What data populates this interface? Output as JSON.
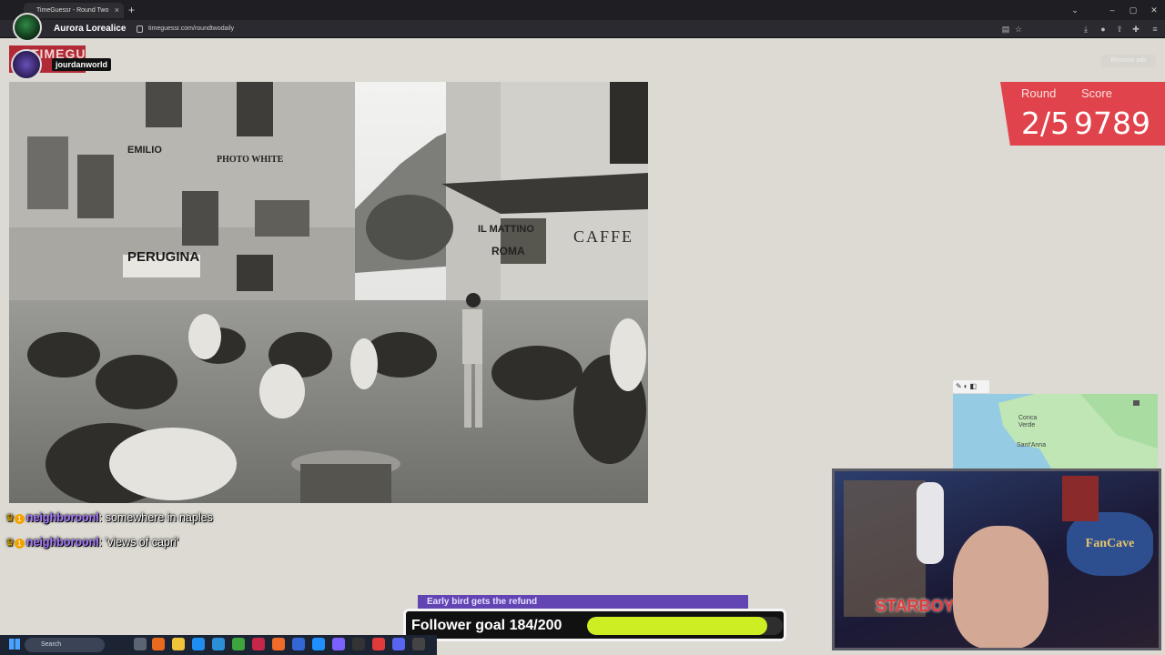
{
  "browser": {
    "tab_title": "TimeGuessr - Round Two",
    "tab_close": "×",
    "new_tab": "+",
    "url": "timeguessr.com/roundtwodaily",
    "profile_name": "Aurora Lorealice",
    "window_controls": {
      "minimize": "–",
      "maximize": "▢",
      "close": "✕",
      "tabs_menu": "⌄"
    }
  },
  "stream_overlay": {
    "username": "jourdanworld",
    "logo_text": "TIMEGUESSR"
  },
  "game": {
    "remove_ads": "Remove ads",
    "round_label": "Round",
    "score_label": "Score",
    "round_value": "2/5",
    "score_value": "9789",
    "photo_signs": {
      "emilio": "EMILIO",
      "photo": "PHOTO WHITE",
      "perugina": "PERUGINA",
      "mattino": "IL MATTINO",
      "roma": "ROMA",
      "caffe": "CAFFE"
    },
    "map": {
      "place_1": "Conca\nVerde",
      "place_2": "Sant'Anna",
      "controls": "✎◐◧"
    }
  },
  "chat": [
    {
      "user": "neighboroonl",
      "message": "somewhere in naples"
    },
    {
      "user": "neighboroonl",
      "message": "'views of capri'"
    }
  ],
  "chat_separator": ": ",
  "chat_badge": "1",
  "goal": {
    "sponsor_text": "Early bird gets the refund",
    "label": "Follower goal 184/200",
    "current": 184,
    "target": 200
  },
  "webcam": {
    "sign": "STARBOY",
    "poster": "FanCave"
  },
  "taskbar": {
    "search_placeholder": "Search"
  },
  "colors": {
    "score_red": "#e0434b",
    "goal_fill": "#ccee22",
    "nick_purple": "#a77bff"
  }
}
